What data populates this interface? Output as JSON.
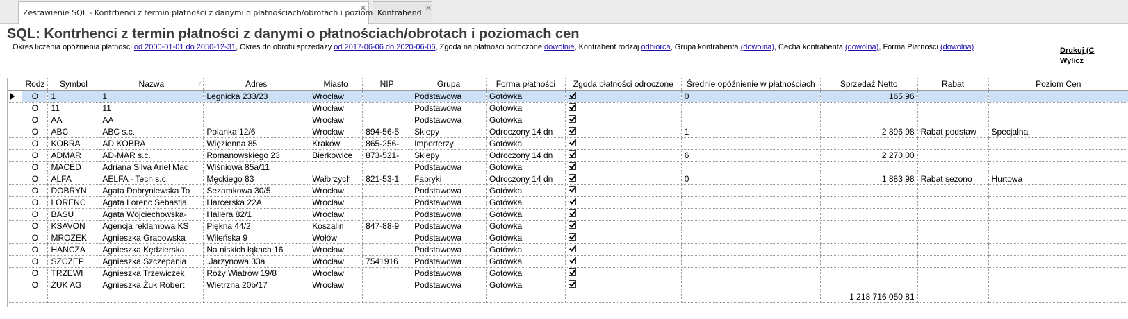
{
  "tabs": [
    {
      "label": "Zestawienie SQL - Kontrhenci z termin płatności z danymi o płatnościach/obrotach i poziomach cen",
      "active": true
    },
    {
      "label": "Kontrahend",
      "active": false
    }
  ],
  "header": {
    "title": "SQL: Kontrhenci z termin płatności z danymi o płatnościach/obrotach i poziomach cen",
    "params": {
      "p1_label": "Okres liczenia opóźnienia płatności ",
      "p1_link": "od 2000-01-01 do 2050-12-31",
      "p2_label": ", Okres do obrotu sprzedaży ",
      "p2_link": "od 2017-06-06 do 2020-06-06",
      "p3_label": ", Zgoda na płatności odroczone ",
      "p3_link": "dowolnie",
      "p4_label": ", Kontrahent rodzaj ",
      "p4_link": "odbiorca",
      "p5_label": ", Grupa kontrahenta ",
      "p5_link": "(dowolna)",
      "p6_label": ", Cecha kontrahenta ",
      "p6_link": "(dowolna)",
      "p7_label": ", Forma Płatności ",
      "p7_link": "(dowolna)"
    },
    "print_link": "Drukuj (C",
    "calc_link": "Wylicz"
  },
  "grid": {
    "columns": [
      "Rodz",
      "Symbol",
      "Nazwa",
      "Adres",
      "Miasto",
      "NIP",
      "Grupa",
      "Forma płatności",
      "Zgoda płatności odroczone",
      "Średnie opóźnienie w płatnościach",
      "Sprzedaż Netto",
      "Rabat",
      "Poziom Cen"
    ],
    "rows": [
      {
        "rodz": "O",
        "symbol": "1",
        "nazwa": "1",
        "adres": "Legnicka 233/23",
        "miasto": "Wrocław",
        "nip": "",
        "grupa": "Podstawowa",
        "forma": "Gotówka",
        "zgoda": true,
        "opoz": "0",
        "sprzedaz": "165,96",
        "rabat": "",
        "poziom": ""
      },
      {
        "rodz": "O",
        "symbol": "11",
        "nazwa": "11",
        "adres": "",
        "miasto": "Wrocław",
        "nip": "",
        "grupa": "Podstawowa",
        "forma": "Gotówka",
        "zgoda": true,
        "opoz": "",
        "sprzedaz": "",
        "rabat": "",
        "poziom": ""
      },
      {
        "rodz": "O",
        "symbol": "AA",
        "nazwa": "AA",
        "adres": "",
        "miasto": "Wrocław",
        "nip": "",
        "grupa": "Podstawowa",
        "forma": "Gotówka",
        "zgoda": true,
        "opoz": "",
        "sprzedaz": "",
        "rabat": "",
        "poziom": ""
      },
      {
        "rodz": "O",
        "symbol": "ABC",
        "nazwa": "ABC s.c.",
        "adres": "Polanka  12/6",
        "miasto": "Wrocław",
        "nip": "894-56-5",
        "grupa": "Sklepy",
        "forma": "Odroczony 14 dn",
        "zgoda": true,
        "opoz": "1",
        "sprzedaz": "2 896,98",
        "rabat": "Rabat podstaw",
        "poziom": "Specjalna"
      },
      {
        "rodz": "O",
        "symbol": "KOBRA",
        "nazwa": "AD KOBRA",
        "adres": "Więzienna  85",
        "miasto": "Kraków",
        "nip": "865-256-",
        "grupa": "Importerzy",
        "forma": "Gotówka",
        "zgoda": true,
        "opoz": "",
        "sprzedaz": "",
        "rabat": "",
        "poziom": ""
      },
      {
        "rodz": "O",
        "symbol": "ADMAR",
        "nazwa": "AD-MAR s.c.",
        "adres": "Romanowskiego 23",
        "miasto": "Bierkowice",
        "nip": "873-521-",
        "grupa": "Sklepy",
        "forma": "Odroczony 14 dn",
        "zgoda": true,
        "opoz": "6",
        "sprzedaz": "2 270,00",
        "rabat": "",
        "poziom": ""
      },
      {
        "rodz": "O",
        "symbol": "MACED",
        "nazwa": "Adriana Silva Ariel Mac",
        "adres": "Wiśniowa 85a/11",
        "miasto": "",
        "nip": "",
        "grupa": "Podstawowa",
        "forma": "Gotówka",
        "zgoda": true,
        "opoz": "",
        "sprzedaz": "",
        "rabat": "",
        "poziom": ""
      },
      {
        "rodz": "O",
        "symbol": "ALFA",
        "nazwa": "AELFA - Tech s.c.",
        "adres": "Męckiego  83",
        "miasto": "Wałbrzych",
        "nip": "821-53-1",
        "grupa": "Fabryki",
        "forma": "Odroczony 14 dn",
        "zgoda": true,
        "opoz": "0",
        "sprzedaz": "1 883,98",
        "rabat": "Rabat sezono",
        "poziom": "Hurtowa"
      },
      {
        "rodz": "O",
        "symbol": "DOBRYN",
        "nazwa": "Agata Dobryniewska To",
        "adres": "Sezamkowa 30/5",
        "miasto": "Wrocław",
        "nip": "",
        "grupa": "Podstawowa",
        "forma": "Gotówka",
        "zgoda": true,
        "opoz": "",
        "sprzedaz": "",
        "rabat": "",
        "poziom": ""
      },
      {
        "rodz": "O",
        "symbol": "LORENC",
        "nazwa": "Agata Lorenc Sebastia",
        "adres": "Harcerska 22A",
        "miasto": "Wrocław",
        "nip": "",
        "grupa": "Podstawowa",
        "forma": "Gotówka",
        "zgoda": true,
        "opoz": "",
        "sprzedaz": "",
        "rabat": "",
        "poziom": ""
      },
      {
        "rodz": "O",
        "symbol": "BASU",
        "nazwa": "Agata Wojciechowska-",
        "adres": "Hallera 82/1",
        "miasto": "Wrocław",
        "nip": "",
        "grupa": "Podstawowa",
        "forma": "Gotówka",
        "zgoda": true,
        "opoz": "",
        "sprzedaz": "",
        "rabat": "",
        "poziom": ""
      },
      {
        "rodz": "O",
        "symbol": "KSAVON",
        "nazwa": "Agencja reklamowa KS",
        "adres": "Piękna  44/2",
        "miasto": "Koszalin",
        "nip": "847-88-9",
        "grupa": "Podstawowa",
        "forma": "Gotówka",
        "zgoda": true,
        "opoz": "",
        "sprzedaz": "",
        "rabat": "",
        "poziom": ""
      },
      {
        "rodz": "O",
        "symbol": "MROZEK",
        "nazwa": "Agnieszka Grabowska",
        "adres": "Wileńska 9",
        "miasto": "Wołów",
        "nip": "",
        "grupa": "Podstawowa",
        "forma": "Gotówka",
        "zgoda": true,
        "opoz": "",
        "sprzedaz": "",
        "rabat": "",
        "poziom": ""
      },
      {
        "rodz": "O",
        "symbol": "HANCZA",
        "nazwa": "Agnieszka Kędzierska",
        "adres": "Na niskich łąkach 16",
        "miasto": "Wrocław",
        "nip": "",
        "grupa": "Podstawowa",
        "forma": "Gotówka",
        "zgoda": true,
        "opoz": "",
        "sprzedaz": "",
        "rabat": "",
        "poziom": ""
      },
      {
        "rodz": "O",
        "symbol": "SZCZEP",
        "nazwa": "Agnieszka Szczepania",
        "adres": ".Jarzynowa 33a",
        "miasto": "Wrocław",
        "nip": "7541916",
        "grupa": "Podstawowa",
        "forma": "Gotówka",
        "zgoda": true,
        "opoz": "",
        "sprzedaz": "",
        "rabat": "",
        "poziom": ""
      },
      {
        "rodz": "O",
        "symbol": "TRZEWI",
        "nazwa": "Agnieszka Trzewiczek",
        "adres": "Róży Wiatrów 19/8",
        "miasto": "Wrocław",
        "nip": "",
        "grupa": "Podstawowa",
        "forma": "Gotówka",
        "zgoda": true,
        "opoz": "",
        "sprzedaz": "",
        "rabat": "",
        "poziom": ""
      },
      {
        "rodz": "O",
        "symbol": "ŻUK AG",
        "nazwa": "Agnieszka Żuk Robert",
        "adres": "Wietrzna 20b/17",
        "miasto": "Wrocław",
        "nip": "",
        "grupa": "Podstawowa",
        "forma": "Gotówka",
        "zgoda": true,
        "opoz": "",
        "sprzedaz": "",
        "rabat": "",
        "poziom": ""
      }
    ],
    "total_sprzedaz": "1 218 716 050,81"
  }
}
